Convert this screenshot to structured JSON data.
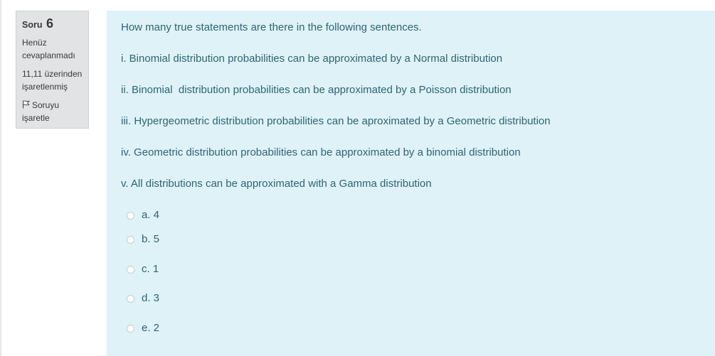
{
  "info": {
    "question_label": "Soru",
    "question_number": "6",
    "state_line1": "Henüz",
    "state_line2": "cevaplanmadı",
    "grade_line1": "11,11 üzerinden",
    "grade_line2": "işaretlenmiş",
    "flag_line1": "Soruyu",
    "flag_line2": "işaretle",
    "flag_icon": "flag-icon"
  },
  "question": {
    "prompt": "How many true statements are there in the following sentences.",
    "statements": [
      "i. Binomial distribution probabilities can be approximated by a Normal distribution",
      "ii. Binomial  distribution probabilities can be approximated by a Poisson distribution",
      "iii. Hypergeometric distribution probabilities can be aproximated by a Geometric distribution",
      "iv. Geometric distribution probabilities can be approximated by a binomial distribution",
      "v. All distributions can be approximated with a Gamma distribution"
    ]
  },
  "answers": [
    {
      "label": "a. 4",
      "selected": false
    },
    {
      "label": "b. 5",
      "selected": false
    },
    {
      "label": "c. 1",
      "selected": false
    },
    {
      "label": "d. 3",
      "selected": false
    },
    {
      "label": "e. 2",
      "selected": false
    }
  ],
  "colors": {
    "info_bg": "#e2e3e5",
    "content_bg": "#def2f8",
    "content_text": "#2f6473"
  }
}
